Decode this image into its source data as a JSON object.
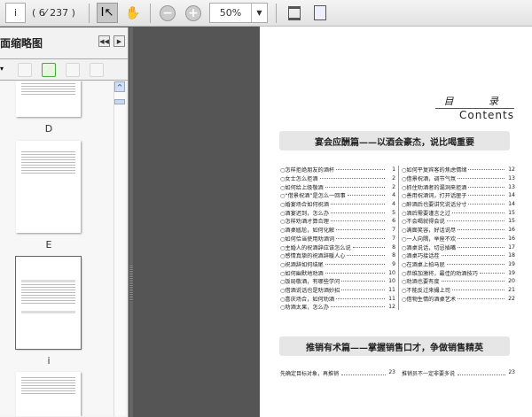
{
  "toolbar": {
    "page_value": "i",
    "page_count": "( 6⁄ 237 )",
    "zoom": "50%"
  },
  "sidebar": {
    "title": "面缩略图",
    "thumb_labels": [
      "D",
      "E",
      "i"
    ]
  },
  "page": {
    "contents_cn": "目 录",
    "contents_en": "Contents",
    "section1": "宴会应酬篇——以酒会豪杰，说比喝重要",
    "left_items": [
      [
        "怎样拒绝朋友的酒杯",
        "1"
      ],
      [
        "女士怎么拒酒",
        "2"
      ],
      [
        "如何给上级敬酒",
        "2"
      ],
      [
        "“借景祝酒”是怎么一回事",
        "4"
      ],
      [
        "婚宴场合如何祝酒",
        "4"
      ],
      [
        "酒宴迟到，怎么办",
        "5"
      ],
      [
        "怎样劝酒才算合理",
        "6"
      ],
      [
        "酒桌尴尬，如何化解",
        "7"
      ],
      [
        "如何恰当使用劝酒词",
        "7"
      ],
      [
        "主婚人的祝酒辞应该怎么说",
        "8"
      ],
      [
        "感情真挚的祝酒辞暖人心",
        "8"
      ],
      [
        "祝酒辞如何结尾",
        "9"
      ],
      [
        "如何幽默地劝酒",
        "10"
      ],
      [
        "饭局敬酒，有哪些学问",
        "10"
      ],
      [
        "借酒说话也是劝酒妙招",
        "11"
      ],
      [
        "喜庆场合，如何劝酒",
        "11"
      ],
      [
        "劝酒太果，怎么办",
        "12"
      ]
    ],
    "right_items": [
      [
        "如何平复宾客的焦虑情绪",
        "12"
      ],
      [
        "借景祝酒，调节气氛",
        "13"
      ],
      [
        "抓住劝酒者的漏洞来拒酒",
        "13"
      ],
      [
        "善用祝酒词，打开话匣子",
        "14"
      ],
      [
        "醉酒后也要讲究说话分寸",
        "14"
      ],
      [
        "酒后需要谨言之过",
        "15"
      ],
      [
        "不会喝就得会说",
        "15"
      ],
      [
        "满面笑容，好话说尽",
        "16"
      ],
      [
        "一人向隅，举座不欢",
        "16"
      ],
      [
        "酒桌说话，切忌插嘴",
        "17"
      ],
      [
        "酒桌巧接话茬",
        "18"
      ],
      [
        "在酒桌上拍马屁",
        "19"
      ],
      [
        "恭维加激将，最佳的劝酒技巧",
        "19"
      ],
      [
        "劝酒也要有度",
        "20"
      ],
      [
        "不能反过来撮上司",
        "21"
      ],
      [
        "借物生情的酒桌艺术",
        "22"
      ]
    ],
    "section2": "推销有术篇——掌握销售口才，争做销售精英",
    "s2_left": [
      "先确定目标对象，再推销",
      "23"
    ],
    "s2_right": [
      "推销员不一定非要多说",
      "23"
    ]
  }
}
